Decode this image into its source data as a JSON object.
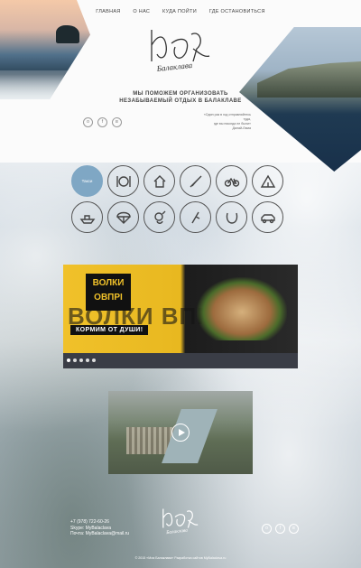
{
  "nav": [
    "ГЛАВНАЯ",
    "О НАС",
    "КУДА ПОЙТИ",
    "ГДЕ ОСТАНОВИТЬСЯ"
  ],
  "logo_text": "Балаклава",
  "tagline": [
    "МЫ ПОМОЖЕМ ОРГАНИЗОВАТЬ",
    "НЕЗАБЫВАЕМЫЙ ОТДЫХ В БАЛАКЛАВЕ"
  ],
  "quote": [
    "«Один раз в год отправляйтесь туда,",
    "где вы никогда не были»",
    "Далай-Лама"
  ],
  "social_icons": [
    "ok-icon",
    "facebook-icon",
    "vk-icon"
  ],
  "grid": {
    "active_label": "Такси",
    "icons": [
      "taxi",
      "restaurant-icon",
      "house-icon",
      "kayak-icon",
      "bicycle-icon",
      "tent-icon",
      "boat-icon",
      "parachute-icon",
      "diving-icon",
      "climbing-icon",
      "horseshoe-icon",
      "car-icon"
    ]
  },
  "banner": {
    "logo_lines": [
      "ВОЛКИ",
      "ОВПРI"
    ],
    "ghost": "ВОЛКИ ВПРI",
    "slogan": "КОРМИМ ОТ ДУШИ!",
    "dots": 5,
    "active_dot": 1
  },
  "footer": {
    "contacts": [
      "+7 (978) 722-60-26",
      "Skype: MyBalaclava",
      "Почта: MyBalaclava@mail.ru"
    ],
    "copyright": "© 2015 «Моя Балаклава» Разработка сайтов MyBalaclava.ru"
  },
  "colors": {
    "accent": "#7fa7c4",
    "banner_yellow": "#f0c12a"
  }
}
